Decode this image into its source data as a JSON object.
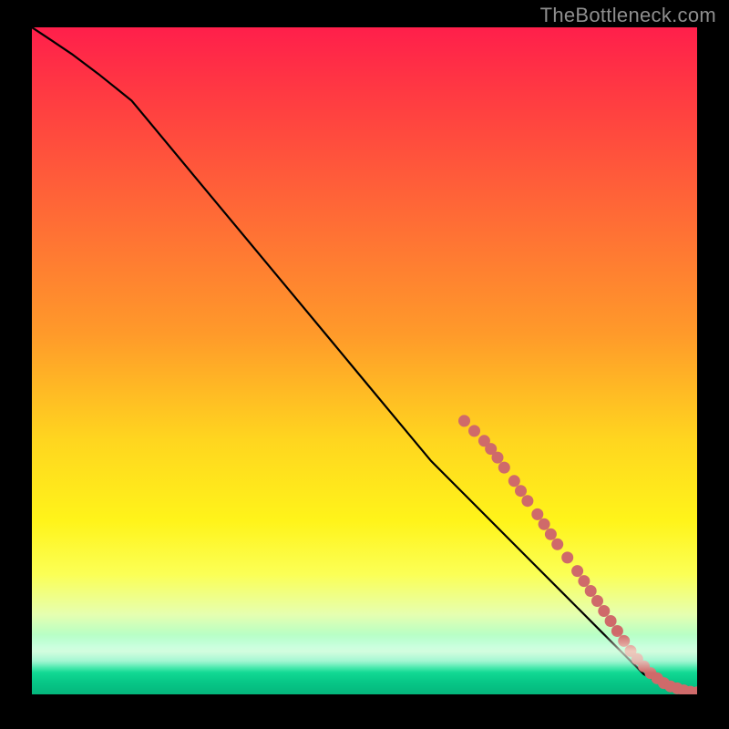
{
  "watermark": "TheBottleneck.com",
  "chart_data": {
    "type": "line",
    "title": "",
    "xlabel": "",
    "ylabel": "",
    "xlim": [
      0,
      100
    ],
    "ylim": [
      0,
      100
    ],
    "grid": false,
    "legend": false,
    "series": [
      {
        "name": "bottleneck-curve",
        "x": [
          0,
          3,
          6,
          10,
          15,
          20,
          25,
          30,
          35,
          40,
          45,
          50,
          55,
          60,
          65,
          70,
          75,
          80,
          85,
          88,
          90,
          92,
          94,
          96,
          98,
          100
        ],
        "y": [
          100,
          98,
          96,
          93,
          89,
          83,
          77,
          71,
          65,
          59,
          53,
          47,
          41,
          35,
          30,
          25,
          20,
          15,
          10,
          7,
          5,
          3,
          2,
          1,
          0.5,
          0.3
        ]
      }
    ],
    "scatter": {
      "name": "sample-points",
      "color": "#cf6a6a",
      "points": [
        {
          "x": 65.0,
          "y": 41.0
        },
        {
          "x": 66.5,
          "y": 39.5
        },
        {
          "x": 68.0,
          "y": 38.0
        },
        {
          "x": 69.0,
          "y": 36.8
        },
        {
          "x": 70.0,
          "y": 35.5
        },
        {
          "x": 71.0,
          "y": 34.0
        },
        {
          "x": 72.5,
          "y": 32.0
        },
        {
          "x": 73.5,
          "y": 30.5
        },
        {
          "x": 74.5,
          "y": 29.0
        },
        {
          "x": 76.0,
          "y": 27.0
        },
        {
          "x": 77.0,
          "y": 25.5
        },
        {
          "x": 78.0,
          "y": 24.0
        },
        {
          "x": 79.0,
          "y": 22.5
        },
        {
          "x": 80.5,
          "y": 20.5
        },
        {
          "x": 82.0,
          "y": 18.5
        },
        {
          "x": 83.0,
          "y": 17.0
        },
        {
          "x": 84.0,
          "y": 15.5
        },
        {
          "x": 85.0,
          "y": 14.0
        },
        {
          "x": 86.0,
          "y": 12.5
        },
        {
          "x": 87.0,
          "y": 11.0
        },
        {
          "x": 88.0,
          "y": 9.5
        },
        {
          "x": 89.0,
          "y": 8.0
        },
        {
          "x": 90.0,
          "y": 6.5
        },
        {
          "x": 91.0,
          "y": 5.3
        },
        {
          "x": 92.0,
          "y": 4.2
        },
        {
          "x": 93.0,
          "y": 3.2
        },
        {
          "x": 94.0,
          "y": 2.4
        },
        {
          "x": 95.0,
          "y": 1.7
        },
        {
          "x": 96.0,
          "y": 1.2
        },
        {
          "x": 97.0,
          "y": 0.9
        },
        {
          "x": 98.0,
          "y": 0.6
        },
        {
          "x": 99.0,
          "y": 0.4
        },
        {
          "x": 100.0,
          "y": 0.3
        }
      ]
    }
  }
}
